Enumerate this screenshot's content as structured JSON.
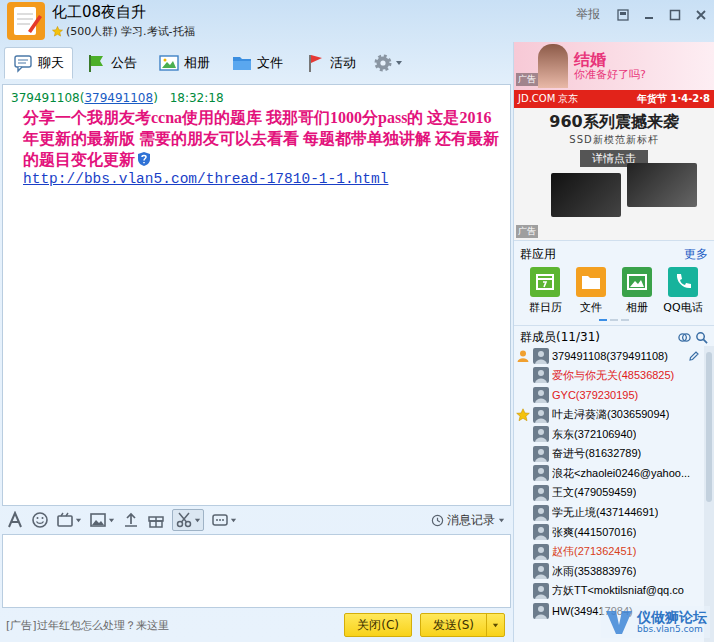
{
  "window": {
    "title": "化工08夜自升",
    "subtitle": "(500人群) 学习.考试-托福",
    "report": "举报"
  },
  "tabs": [
    {
      "label": "聊天",
      "selected": true
    },
    {
      "label": "公告",
      "selected": false
    },
    {
      "label": "相册",
      "selected": false
    },
    {
      "label": "文件",
      "selected": false
    },
    {
      "label": "活动",
      "selected": false
    }
  ],
  "messages": [
    {
      "sender": "379491108(",
      "sender_id": "379491108",
      "sender_end": ")",
      "time": "18:32:18",
      "text": "分享一个我朋友考ccna使用的题库 我那哥们1000分pass的 这是2016年更新的最新版 需要的朋友可以去看看 每题都带单独讲解 还有最新的题目变化更新",
      "link": "http://bbs.vlan5.com/thread-17810-1-1.html"
    }
  ],
  "toolbar": {
    "history": "消息记录"
  },
  "bottom_bar": {
    "ad": "[广告]过年红包怎么处理？来这里",
    "buttons": [
      {
        "label": "关闭(C)",
        "dropdown": false
      },
      {
        "label": "发送(S)",
        "dropdown": true
      }
    ]
  },
  "ads": {
    "top": {
      "label": "广告",
      "title": "结婚",
      "subtitle": "你准备好了吗?"
    },
    "main": {
      "brand": "JD.COM 京东",
      "event": "年货节 1·4-2·8",
      "headline": "960系列震撼来袭",
      "tagline": "SSD新模范新标杆",
      "button": "详情点击",
      "label": "广告"
    }
  },
  "group_apps": {
    "title": "群应用",
    "more": "更多",
    "items": [
      {
        "label": "群日历",
        "color": "#5cb531"
      },
      {
        "label": "文件",
        "color": "#f4a020"
      },
      {
        "label": "相册",
        "color": "#3aa24a"
      },
      {
        "label": "QQ电话",
        "color": "#17b39c"
      }
    ]
  },
  "members": {
    "title": "群成员(11/31)",
    "items": [
      {
        "name": "379491108(379491108)",
        "role": "owner",
        "color": "#000000"
      },
      {
        "name": "爱你与你无关(48536825)",
        "role": "member",
        "color": "#e0201b"
      },
      {
        "name": "GYC(379230195)",
        "role": "member",
        "color": "#e0201b"
      },
      {
        "name": "叶走浔葵潞(303659094)",
        "role": "admin",
        "color": "#000000"
      },
      {
        "name": "东东(372106940)",
        "role": "member",
        "color": "#000000"
      },
      {
        "name": "奋进号(81632789)",
        "role": "member",
        "color": "#000000"
      },
      {
        "name": "浪花<zhaolei0246@yahoo...",
        "role": "member",
        "color": "#000000"
      },
      {
        "name": "王文(479059459)",
        "role": "member",
        "color": "#000000"
      },
      {
        "name": "学无止境(437144691)",
        "role": "member",
        "color": "#000000"
      },
      {
        "name": "张爽(441507016)",
        "role": "member",
        "color": "#000000"
      },
      {
        "name": "赵伟(271362451)",
        "role": "member",
        "color": "#d8401a"
      },
      {
        "name": "冰雨(353883976)",
        "role": "member",
        "color": "#000000"
      },
      {
        "name": "方妖TT<moktilsniaf@qq.co",
        "role": "member",
        "color": "#000000"
      },
      {
        "name": "HW(349417984)",
        "role": "member",
        "color": "#000000"
      }
    ]
  },
  "watermark": {
    "title": "仪做狮论坛",
    "url": "bbs.vlan5.com"
  }
}
